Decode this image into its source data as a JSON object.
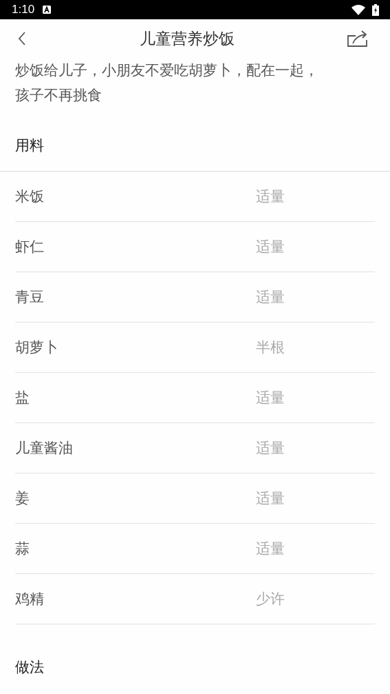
{
  "status_bar": {
    "time": "1:10"
  },
  "header": {
    "title": "儿童营养炒饭"
  },
  "description": [
    "炒饭给儿子，小朋友不爱吃胡萝卜，配在一起，",
    "孩子不再挑食"
  ],
  "ingredients": {
    "heading": "用料",
    "items": [
      {
        "name": "米饭",
        "amount": "适量"
      },
      {
        "name": "虾仁",
        "amount": "适量"
      },
      {
        "name": "青豆",
        "amount": "适量"
      },
      {
        "name": "胡萝卜",
        "amount": "半根"
      },
      {
        "name": "盐",
        "amount": "适量"
      },
      {
        "name": "儿童酱油",
        "amount": "适量"
      },
      {
        "name": "姜",
        "amount": "适量"
      },
      {
        "name": "蒜",
        "amount": "适量"
      },
      {
        "name": "鸡精",
        "amount": "少许"
      }
    ]
  },
  "steps": {
    "heading": "做法"
  }
}
